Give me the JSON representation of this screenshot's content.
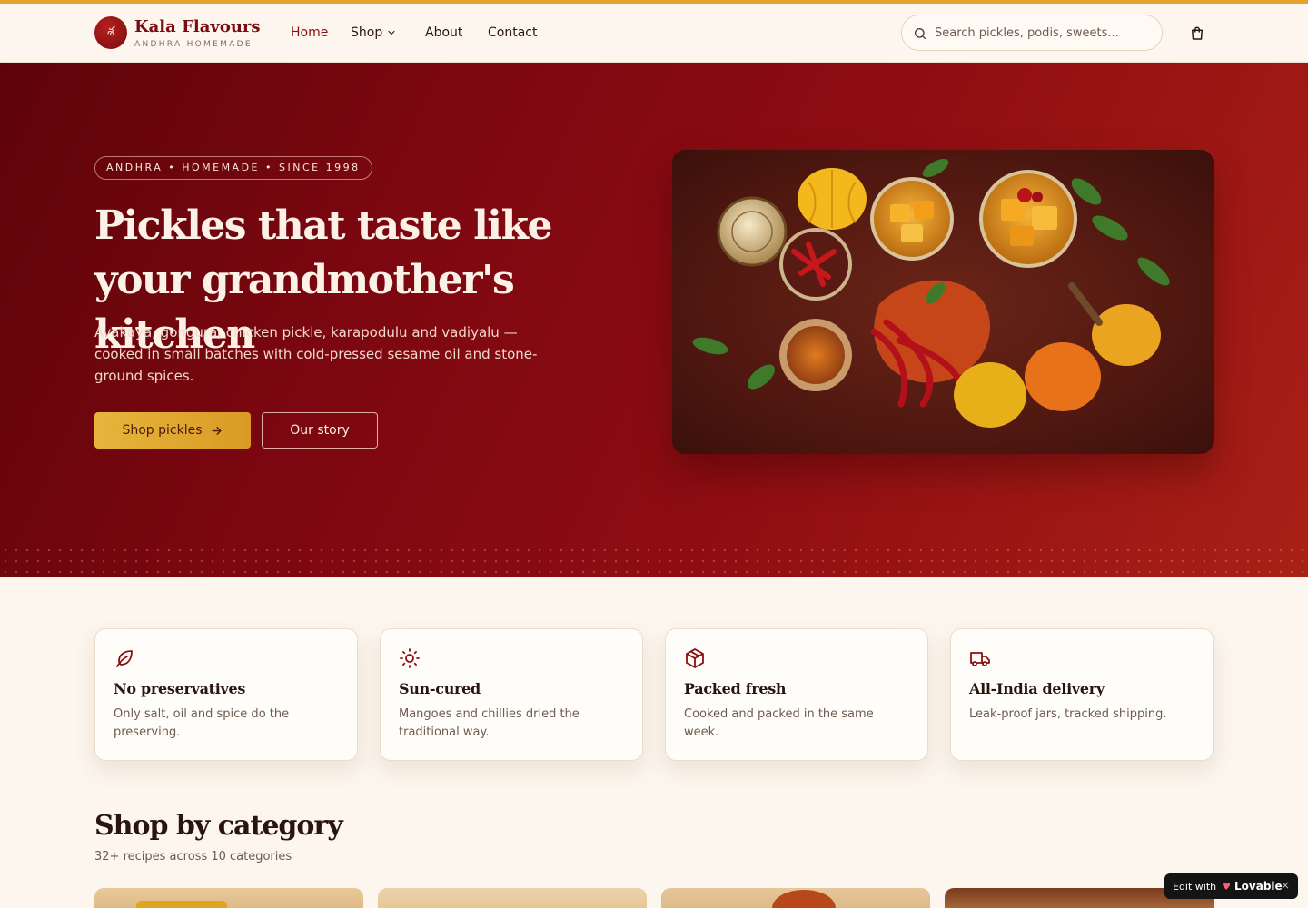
{
  "header": {
    "brand": "Kala Flavours",
    "brand_sub": "ANDHRA HOMEMADE",
    "logo_glyph": "శ",
    "nav": [
      "Home",
      "Shop",
      "About",
      "Contact"
    ],
    "search_placeholder": "Search pickles, podis, sweets..."
  },
  "hero": {
    "pill": "ANDHRA • HOMEMADE • SINCE 1998",
    "title": "Pickles that taste like your grandmother's kitchen",
    "description": "Avakaya, gongura, chicken pickle, karapodulu and vadiyalu — cooked in small batches with cold-pressed sesame oil and stone-ground spices.",
    "primary_button": "Shop pickles",
    "secondary_button": "Our story"
  },
  "features": [
    {
      "title": "No preservatives",
      "desc": "Only salt, oil and spice do the preserving.",
      "icon": "leaf-icon"
    },
    {
      "title": "Sun-cured",
      "desc": "Mangoes and chillies dried the traditional way.",
      "icon": "sun-icon"
    },
    {
      "title": "Packed fresh",
      "desc": "Cooked and packed in the same week.",
      "icon": "package-icon"
    },
    {
      "title": "All-India delivery",
      "desc": "Leak-proof jars, tracked shipping.",
      "icon": "truck-icon"
    }
  ],
  "categories": {
    "title": "Shop by category",
    "subtitle": "32+ recipes across 10 categories"
  },
  "badge": {
    "edit": "Edit with",
    "brand": "Lovable",
    "close": "×"
  },
  "colors": {
    "accent": "#8a0f12",
    "gold": "#e3a32c",
    "background": "#fcf6ee"
  }
}
